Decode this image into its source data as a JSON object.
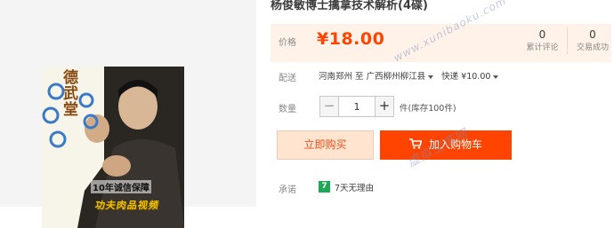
{
  "product": {
    "title": "杨俊敏博士擒拿技术解析(4碟)",
    "image": {
      "title_vertical": "德武堂",
      "badge": "10年诚信保障",
      "bottom_text": "功夫肉品视频",
      "icon": "martial-artist-photo"
    }
  },
  "price": {
    "label": "价格",
    "value": "¥18.00",
    "color": "#ff4400"
  },
  "stats": {
    "reviews": {
      "count": "0",
      "label": "累计评论"
    },
    "sales": {
      "count": "0",
      "label": "交易成功"
    }
  },
  "shipping": {
    "label": "配送",
    "from": "河南郑州",
    "to_word": "至",
    "destination": "广西柳州柳江县",
    "method": "快递 ¥10.00"
  },
  "quantity": {
    "label": "数量",
    "minus": "−",
    "value": "1",
    "plus": "+",
    "stock": "件(库存100件)"
  },
  "actions": {
    "buy_now": "立即购买",
    "add_to_cart": "加入购物车",
    "cart_icon": "shopping-cart-icon",
    "accent": "#ff4400"
  },
  "promise": {
    "label": "承诺",
    "icon_text": "7",
    "text": "7天无理由"
  },
  "watermarks": {
    "url": "www.xunibaoku.com",
    "name": "虚拟宝库网"
  }
}
